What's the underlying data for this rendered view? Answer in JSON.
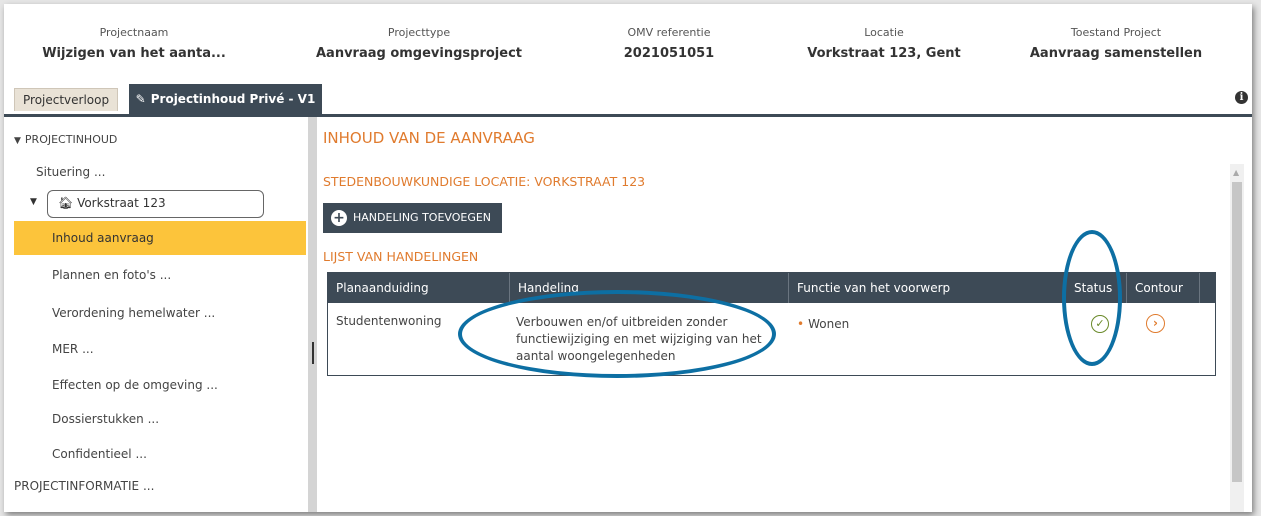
{
  "header": {
    "fields": [
      {
        "label": "Projectnaam",
        "value": "Wijzigen van het aanta..."
      },
      {
        "label": "Projecttype",
        "value": "Aanvraag omgevingsproject"
      },
      {
        "label": "OMV referentie",
        "value": "2021051051"
      },
      {
        "label": "Locatie",
        "value": "Vorkstraat 123, Gent"
      },
      {
        "label": "Toestand Project",
        "value": "Aanvraag samenstellen"
      }
    ]
  },
  "tabs": {
    "tab1": "Projectverloop",
    "tab2": "Projectinhoud Privé - V1"
  },
  "sidebar": {
    "root": "PROJECTINHOUD",
    "situering": "Situering ...",
    "location": "Vorkstraat 123",
    "items": [
      "Inhoud aanvraag",
      "Plannen en foto's ...",
      "Verordening hemelwater ...",
      "MER ...",
      "Effecten op de omgeving ...",
      "Dossierstukken ...",
      "Confidentieel ..."
    ],
    "projectinfo": "PROJECTINFORMATIE ..."
  },
  "main": {
    "title": "INHOUD VAN DE AANVRAAG",
    "subtitle": "STEDENBOUWKUNDIGE LOCATIE: VORKSTRAAT 123",
    "add_button": "HANDELING TOEVOEGEN",
    "list_title": "LIJST VAN HANDELINGEN",
    "table": {
      "headers": [
        "Planaanduiding",
        "Handeling",
        "Functie van het voorwerp",
        "Status",
        "Contour"
      ],
      "rows": [
        {
          "planaanduiding": "Studentenwoning",
          "handeling_lines": [
            "Verbouwen en/of uitbreiden zonder",
            "functiewijziging en met wijziging van het",
            "aantal woongelegenheden"
          ],
          "functie": "Wonen"
        }
      ]
    }
  },
  "colors": {
    "accent": "#e07b2e",
    "dark": "#3d4a56",
    "active": "#fcc43b",
    "annotation": "#0d6fa3",
    "status_ok": "#6a8a2a"
  },
  "icons": {
    "tab_edit": "pencil-icon",
    "location": "home-icon",
    "add": "plus-circle-icon",
    "status": "check-circle-icon",
    "contour": "chevron-right-circle-icon",
    "info": "info-icon"
  }
}
